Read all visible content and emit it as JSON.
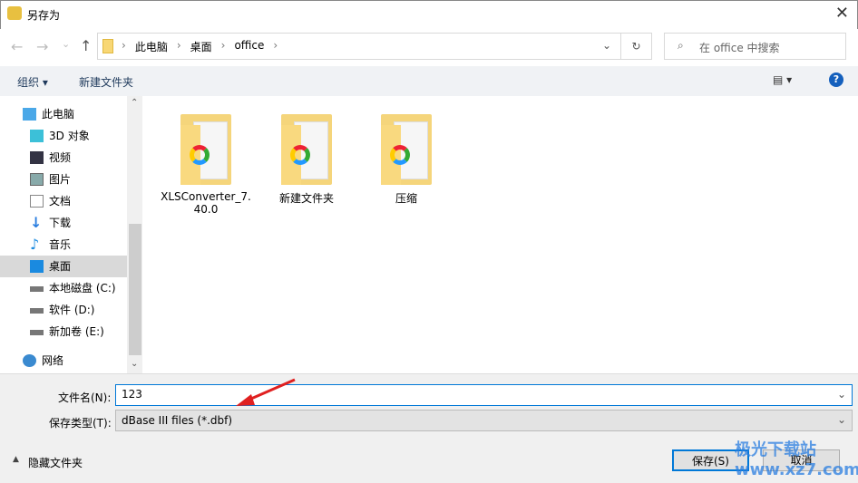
{
  "window": {
    "title": "另存为",
    "close": "✕"
  },
  "nav": {
    "back": "←",
    "forward": "→",
    "recent": "⌄",
    "up": "↑",
    "breadcrumbs": [
      "此电脑",
      "桌面",
      "office"
    ],
    "refresh": "↻",
    "search_placeholder": "在 office 中搜索"
  },
  "toolbar": {
    "organize": "组织 ▾",
    "new_folder": "新建文件夹",
    "view": "▤ ▾",
    "help": "?"
  },
  "sidebar": {
    "items": [
      {
        "label": "此电脑"
      },
      {
        "label": "3D 对象"
      },
      {
        "label": "视频"
      },
      {
        "label": "图片"
      },
      {
        "label": "文档"
      },
      {
        "label": "下载"
      },
      {
        "label": "音乐"
      },
      {
        "label": "桌面",
        "selected": true
      },
      {
        "label": "本地磁盘 (C:)"
      },
      {
        "label": "软件 (D:)"
      },
      {
        "label": "新加卷 (E:)"
      },
      {
        "label": "网络"
      }
    ]
  },
  "files": [
    {
      "name": "XLSConverter_7.40.0"
    },
    {
      "name": "新建文件夹"
    },
    {
      "name": "压缩"
    }
  ],
  "form": {
    "filename_label": "文件名(N):",
    "filename_value": "123",
    "filetype_label": "保存类型(T):",
    "filetype_value": "dBase III files (*.dbf)"
  },
  "footer": {
    "hide_folders": "隐藏文件夹",
    "save": "保存(S)",
    "cancel": "取消",
    "watermark": "极光下载站 www.xz7.com"
  },
  "colors": {
    "accent": "#0078d7",
    "arrow": "#e02020"
  }
}
